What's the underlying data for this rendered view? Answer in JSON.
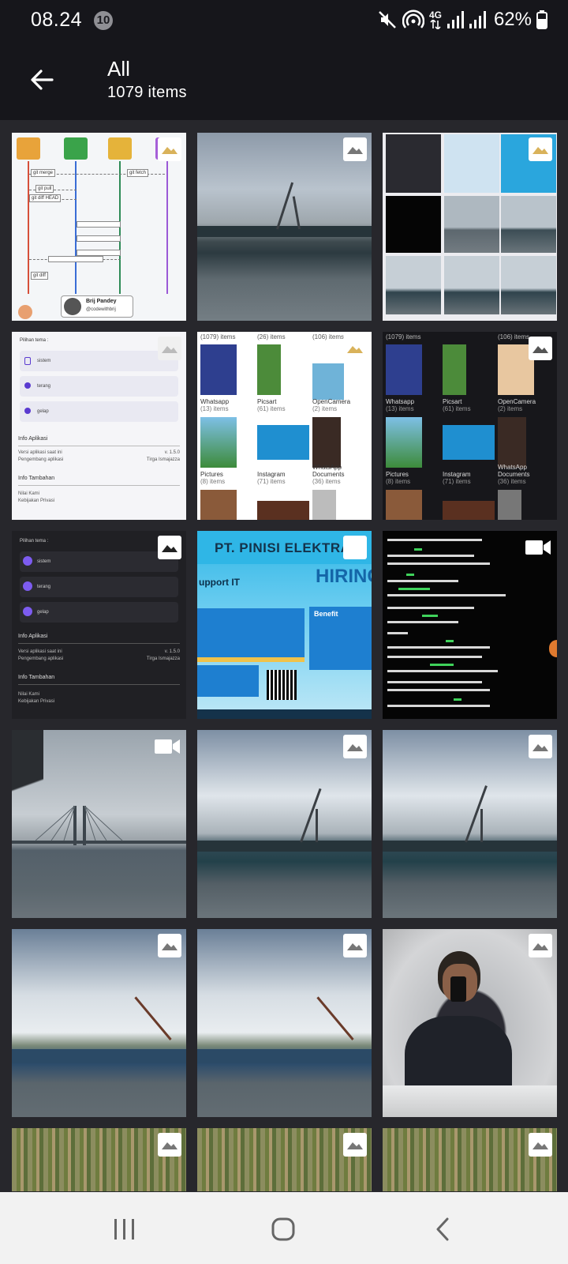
{
  "status_bar": {
    "time": "08.24",
    "notification_count": "10",
    "network_label": "4G",
    "battery": "62%",
    "icons": [
      "mute-icon",
      "hotspot-icon",
      "signal-icon",
      "signal-icon",
      "battery-icon"
    ]
  },
  "header": {
    "title": "All",
    "item_count": "1079 items",
    "back_icon": "arrow-left-icon"
  },
  "grid": {
    "tiles": [
      {
        "kind": "image",
        "content": "git-diagram-screenshot",
        "caption_name": "Brij Pandey",
        "caption_handle": "@codewithbrij"
      },
      {
        "kind": "image",
        "content": "harbor-photo"
      },
      {
        "kind": "image",
        "content": "collage-screenshot"
      },
      {
        "kind": "image",
        "content": "settings-light-screenshot"
      },
      {
        "kind": "image",
        "content": "folders-light-screenshot"
      },
      {
        "kind": "image",
        "content": "folders-dark-screenshot"
      },
      {
        "kind": "image",
        "content": "settings-dark-screenshot"
      },
      {
        "kind": "image",
        "content": "job-poster",
        "poster_title": "PT. PINISI ELEKTRA",
        "poster_hiring": "HIRING",
        "poster_support": "upport IT",
        "poster_benefit": "Benefit"
      },
      {
        "kind": "video",
        "content": "terminal-screenshot"
      },
      {
        "kind": "video",
        "content": "bridge-photo"
      },
      {
        "kind": "image",
        "content": "harbor-photo"
      },
      {
        "kind": "image",
        "content": "harbor-photo"
      },
      {
        "kind": "image",
        "content": "port-photo"
      },
      {
        "kind": "image",
        "content": "port-photo"
      },
      {
        "kind": "image",
        "content": "selfie-photo"
      },
      {
        "kind": "image",
        "content": "grass-photo"
      },
      {
        "kind": "image",
        "content": "grass-photo"
      },
      {
        "kind": "image",
        "content": "grass-photo"
      }
    ]
  },
  "settings_screen": {
    "theme_heading": "Pilihan tema :",
    "theme_options": [
      "sistem",
      "terang",
      "gelap"
    ],
    "info_heading": "Info Aplikasi",
    "version_label": "Versi aplikasi saat ini",
    "version_value": "v. 1.5.0",
    "developer_label": "Pengembang aplikasi",
    "developer_value": "Tirga Ismajazza",
    "extra_heading": "Info Tambahan",
    "rate_label": "Nilai Kami",
    "privacy_label": "Kebijakan Privasi"
  },
  "folders_screen": {
    "top_counts": [
      "(1079) items",
      "(26) items",
      "(106) items"
    ],
    "folders": [
      {
        "name": "Whatsapp",
        "count": "(13) items"
      },
      {
        "name": "Picsart",
        "count": "(61) items"
      },
      {
        "name": "OpenCamera",
        "count": "(2) items"
      },
      {
        "name": "Pictures",
        "count": "(8) items"
      },
      {
        "name": "Instagram",
        "count": "(71) items"
      },
      {
        "name": "WhatsApp Documents",
        "count": "(36) items"
      }
    ]
  },
  "nav_bar": {
    "icons": [
      "recents-icon",
      "home-icon",
      "back-icon"
    ]
  },
  "colors": {
    "background": "#16161b",
    "grid_background": "#27272c",
    "nav_background": "#f2f2f2"
  }
}
